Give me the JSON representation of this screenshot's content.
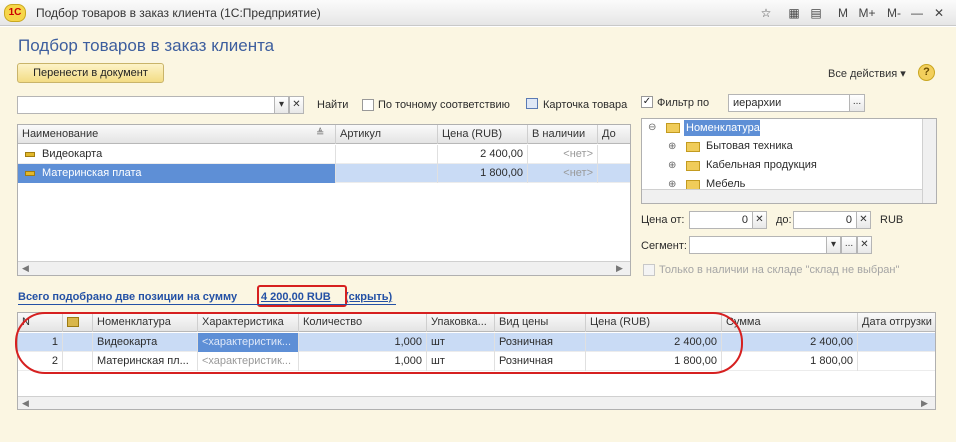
{
  "window": {
    "title": "Подбор товаров в заказ клиента  (1С:Предприятие)",
    "logo": "1С",
    "toolbar": [
      "M",
      "M+",
      "M-"
    ]
  },
  "page": {
    "heading": "Подбор товаров в заказ клиента",
    "transfer_button": "Перенести в документ",
    "all_actions": "Все действия ▾",
    "help": "?"
  },
  "search": {
    "value": "",
    "find_label": "Найти",
    "exact_match_label": "По точному соответствию",
    "card_label": "Карточка товара"
  },
  "filter": {
    "label": "Фильтр по",
    "value": "иерархии",
    "price_from_label": "Цена от:",
    "price_from": "0",
    "price_to_label": "до:",
    "price_to": "0",
    "currency": "RUB",
    "segment_label": "Сегмент:",
    "segment": "",
    "stock_label": "Только в наличии на складе \"склад не выбран\""
  },
  "products": {
    "headers": [
      "Наименование",
      "Артикул",
      "Цена (RUB)",
      "В наличии",
      "До"
    ],
    "rows": [
      {
        "name": "Видеокарта",
        "article": "",
        "price": "2 400,00",
        "stock": "<нет>"
      },
      {
        "name": "Материнская плата",
        "article": "",
        "price": "1 800,00",
        "stock": "<нет>"
      }
    ]
  },
  "tree": {
    "items": [
      "Номенклатура",
      "Бытовая техника",
      "Кабельная продукция",
      "Мебель"
    ]
  },
  "summary": {
    "prefix": "Всего подобрано две позиции на сумму",
    "amount": "4 200,00 RUB",
    "hide": "(скрыть)"
  },
  "selected": {
    "headers": [
      "N",
      "",
      "Номенклатура",
      "Характеристика",
      "Количество",
      "Упаковка...",
      "Вид цены",
      "Цена (RUB)",
      "Сумма",
      "Дата отгрузки"
    ],
    "rows": [
      {
        "n": "1",
        "item": "Видеокарта",
        "char": "<характеристик...",
        "qty": "1,000",
        "unit": "шт",
        "price_type": "Розничная",
        "price": "2 400,00",
        "sum": "2 400,00"
      },
      {
        "n": "2",
        "item": "Материнская пл...",
        "char": "<характеристик...",
        "qty": "1,000",
        "unit": "шт",
        "price_type": "Розничная",
        "price": "1 800,00",
        "sum": "1 800,00"
      }
    ]
  }
}
